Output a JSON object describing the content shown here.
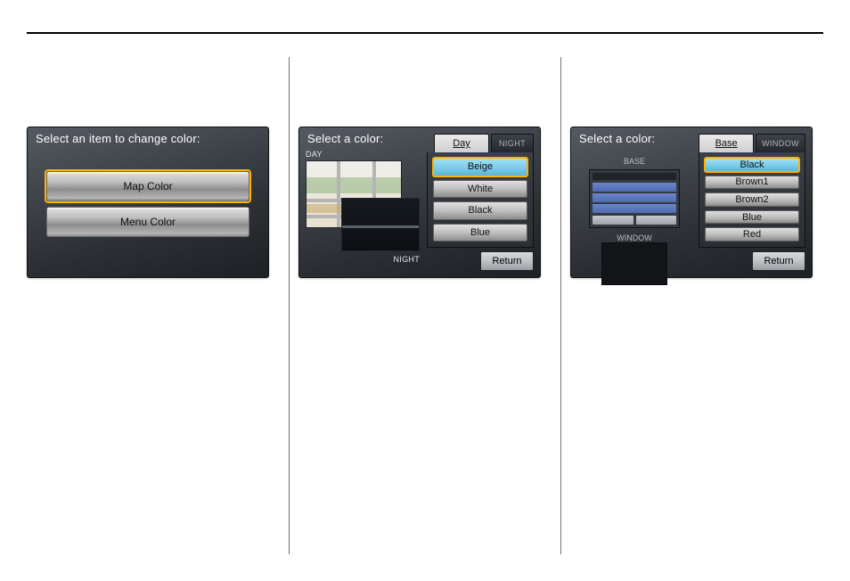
{
  "screens": [
    {
      "title": "Select an item to change color:",
      "items": [
        {
          "label": "Map Color",
          "selected": true
        },
        {
          "label": "Menu Color",
          "selected": false
        }
      ]
    },
    {
      "title": "Select a color:",
      "tabs": [
        {
          "label": "Day",
          "style": "light",
          "active": true
        },
        {
          "label": "NIGHT",
          "style": "dark",
          "active": false
        }
      ],
      "options": [
        {
          "label": "Beige",
          "selected": true
        },
        {
          "label": "White",
          "selected": false
        },
        {
          "label": "Black",
          "selected": false
        },
        {
          "label": "Blue",
          "selected": false
        }
      ],
      "preview": {
        "top_label": "DAY",
        "bottom_label": "NIGHT"
      },
      "return_label": "Return"
    },
    {
      "title": "Select a color:",
      "tabs": [
        {
          "label": "Base",
          "style": "light",
          "active": true
        },
        {
          "label": "WINDOW",
          "style": "dark",
          "active": false
        }
      ],
      "options": [
        {
          "label": "Black",
          "selected": true
        },
        {
          "label": "Brown1",
          "selected": false
        },
        {
          "label": "Brown2",
          "selected": false
        },
        {
          "label": "Blue",
          "selected": false
        },
        {
          "label": "Red",
          "selected": false
        }
      ],
      "preview": {
        "top_label": "BASE",
        "bottom_label": "WINDOW"
      },
      "return_label": "Return"
    }
  ]
}
